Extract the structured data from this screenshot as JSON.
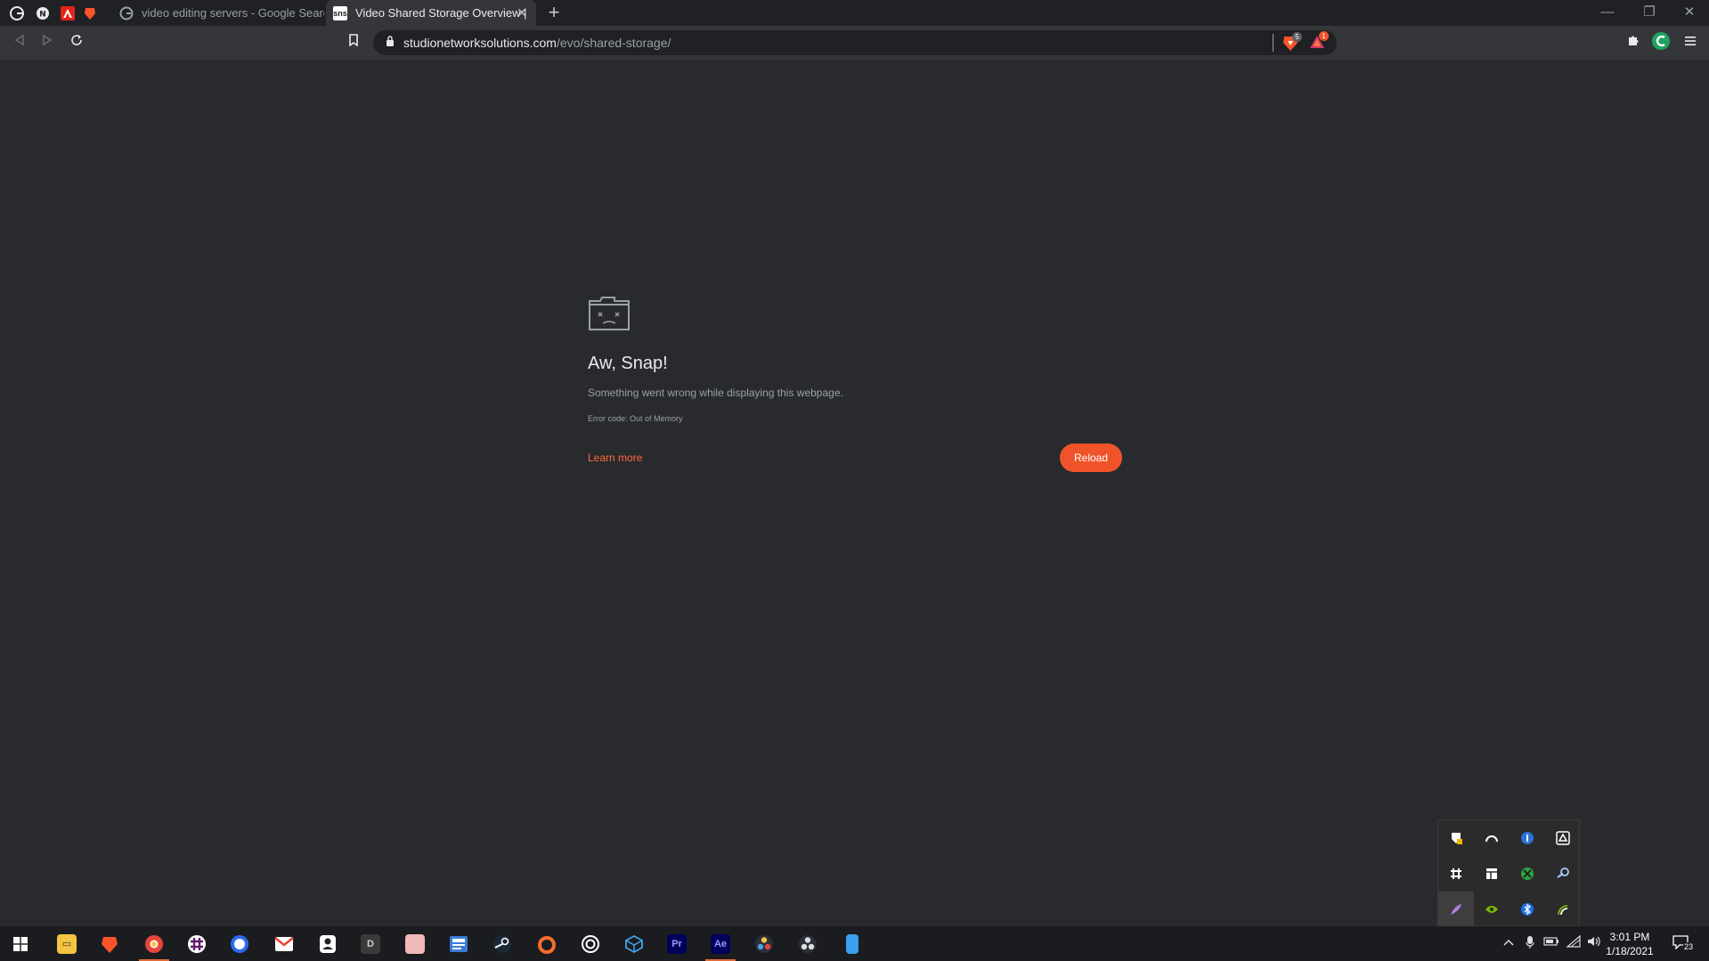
{
  "browser": {
    "tabs": [
      {
        "title": "video editing servers - Google Search",
        "active": false
      },
      {
        "title": "Video Shared Storage Overview |",
        "active": true
      }
    ],
    "new_tab_label": "+",
    "window_controls": {
      "minimize": "—",
      "restore": "❐",
      "close": "✕"
    }
  },
  "toolbar": {
    "url_host": "studionetworksolutions.com",
    "url_path": "/evo/shared-storage/",
    "brave_shields_count": "5",
    "rewards_count": "1"
  },
  "crash_page": {
    "title": "Aw, Snap!",
    "message": "Something went wrong while displaying this webpage.",
    "error_code": "Error code: Out of Memory",
    "learn_more": "Learn more",
    "reload": "Reload"
  },
  "taskbar": {
    "time": "3:01 PM",
    "date": "1/18/2021",
    "notification_count": "23",
    "apps": [
      {
        "name": "start-button",
        "label": "start"
      },
      {
        "name": "file-explorer",
        "label": "File Explorer"
      },
      {
        "name": "brave",
        "label": "Brave"
      },
      {
        "name": "chrome-canary",
        "label": "Chrome"
      },
      {
        "name": "slack",
        "label": "Slack"
      },
      {
        "name": "signal",
        "label": "Signal"
      },
      {
        "name": "gmail",
        "label": "Gmail"
      },
      {
        "name": "contacts",
        "label": "Contacts"
      },
      {
        "name": "app-d",
        "label": "D"
      },
      {
        "name": "image-app",
        "label": "Image"
      },
      {
        "name": "news-app",
        "label": "News"
      },
      {
        "name": "steam",
        "label": "Steam"
      },
      {
        "name": "origin",
        "label": "Origin"
      },
      {
        "name": "uplay",
        "label": "Uplay"
      },
      {
        "name": "blender",
        "label": "Blender"
      },
      {
        "name": "premiere",
        "label": "Pr"
      },
      {
        "name": "after-effects",
        "label": "Ae"
      },
      {
        "name": "davinci",
        "label": "DaVinci"
      },
      {
        "name": "davinci-2",
        "label": "DaVinci 2"
      },
      {
        "name": "notepad",
        "label": "Notepad"
      }
    ]
  },
  "colors": {
    "accent": "#f0532a",
    "link": "#ff6a3d",
    "page_bg": "#292a2d",
    "tabstrip_bg": "#202124",
    "toolbar_bg": "#35363a"
  }
}
